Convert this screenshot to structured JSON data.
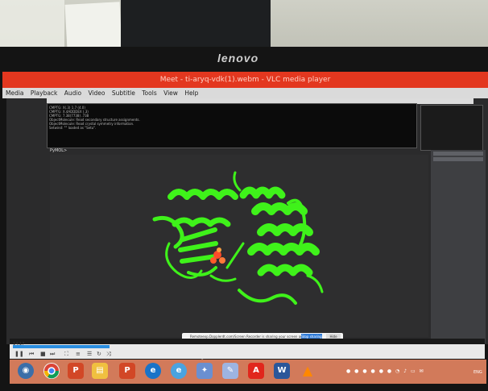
{
  "monitor": {
    "brand": "lenovo"
  },
  "window": {
    "title": "Meet - ti-aryq-vdk(1).webm - VLC media player"
  },
  "menu": [
    "Media",
    "Playback",
    "Audio",
    "Video",
    "Subtitle",
    "Tools",
    "View",
    "Help"
  ],
  "pymol": {
    "console_lines": [
      "CMPTG: X(.3)  1.7  (4.0)",
      "CMPTG: X.4ADDDEX  (.3)",
      "CMPTG: 7.38(7738) .738",
      "ObjectMolecule: Read secondary structure assignments.",
      "ObjectMolecule: Read crystal symmetry information.",
      "Setwind: \"\" loaded as \"Setu\"."
    ],
    "prompt": "PyMOL>"
  },
  "vlc": {
    "time": "14:17"
  },
  "notification": {
    "text": "Remoteexp.Dopplerdt.com/Screen Recorder is sharing your screen and audio.",
    "action": "Stop sharing",
    "hide": "Hide"
  },
  "taskbar": {
    "icons": [
      "chrome",
      "powerpoint",
      "file-explorer",
      "powerpoint-2",
      "edge",
      "internet-explorer",
      "app",
      "paint",
      "acrobat",
      "word",
      "vlc"
    ],
    "language": "ENG"
  }
}
